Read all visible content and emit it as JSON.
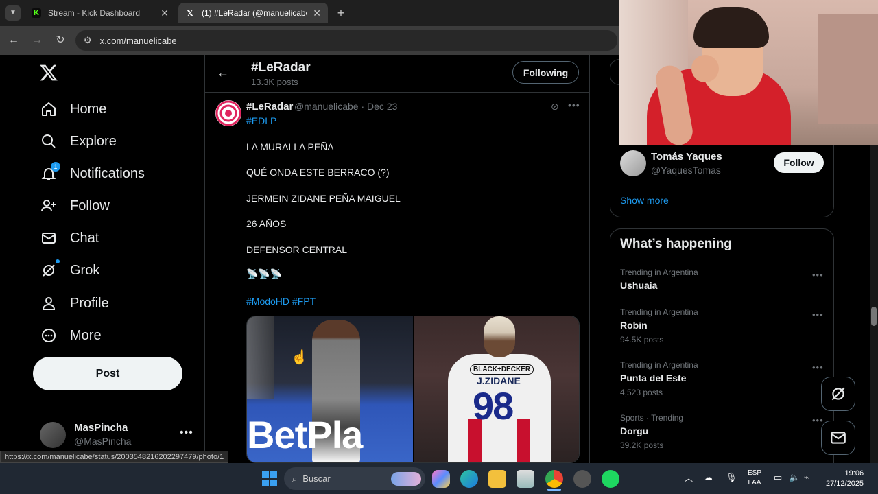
{
  "browser": {
    "tabs": [
      {
        "title": "Stream - Kick Dashboard",
        "active": false
      },
      {
        "title": "(1) #LeRadar (@manuelicabe) /",
        "active": true
      }
    ],
    "url": "x.com/manuelicabe",
    "status_url": "https://x.com/manuelicabe/status/2003548216202297479/photo/1"
  },
  "nav": {
    "items": [
      {
        "label": "Home",
        "icon": "home-icon"
      },
      {
        "label": "Explore",
        "icon": "search-icon"
      },
      {
        "label": "Notifications",
        "icon": "bell-icon",
        "badge": "1"
      },
      {
        "label": "Follow",
        "icon": "person-plus-icon"
      },
      {
        "label": "Chat",
        "icon": "mail-icon"
      },
      {
        "label": "Grok",
        "icon": "grok-icon"
      },
      {
        "label": "Profile",
        "icon": "person-icon"
      },
      {
        "label": "More",
        "icon": "more-circle-icon"
      }
    ],
    "post_label": "Post",
    "account": {
      "name": "MasPincha",
      "handle": "@MasPincha"
    }
  },
  "header": {
    "title": "#LeRadar",
    "count": "13.3K posts",
    "following_label": "Following"
  },
  "tweet": {
    "name": "#LeRadar",
    "meta": "@manuelicabe · Dec 23",
    "lines": [
      {
        "text": "#EDLP",
        "hashtag": true
      },
      {
        "text": "LA MURALLA PEÑA"
      },
      {
        "text": "QUÉ ONDA ESTE BERRACO (?)"
      },
      {
        "text": "JERMEIN ZIDANE PEÑA MAIGUEL"
      },
      {
        "text": "26 AÑOS"
      },
      {
        "text": "DEFENSOR CENTRAL"
      },
      {
        "text": "📡📡📡"
      },
      {
        "text": "#ModoHD #FPT",
        "hashtag": true
      }
    ],
    "photo2_text_top": "BLACK+DECKER",
    "photo2_name": "J.ZIDANE",
    "photo2_number": "98",
    "photo1_text": "BetPla"
  },
  "who_to_follow": {
    "name": "Tomás Yaques",
    "handle": "@YaquesTomas",
    "follow_label": "Follow",
    "show_more": "Show more"
  },
  "happening": {
    "title": "What’s happening",
    "trends": [
      {
        "context": "Trending in Argentina",
        "name": "Ushuaia",
        "count": ""
      },
      {
        "context": "Trending in Argentina",
        "name": "Robin",
        "count": "94.5K posts"
      },
      {
        "context": "Trending in Argentina",
        "name": "Punta del Este",
        "count": "4,523 posts"
      },
      {
        "context": "Sports · Trending",
        "name": "Dorgu",
        "count": "39.2K posts"
      }
    ]
  },
  "taskbar": {
    "search_placeholder": "Buscar",
    "lang_top": "ESP",
    "lang_bottom": "LAA",
    "time": "19:06",
    "date": "27/12/2025"
  },
  "colors": {
    "accent": "#1d9bf0",
    "background": "#000000",
    "border": "#2f3336",
    "muted": "#71767b"
  }
}
